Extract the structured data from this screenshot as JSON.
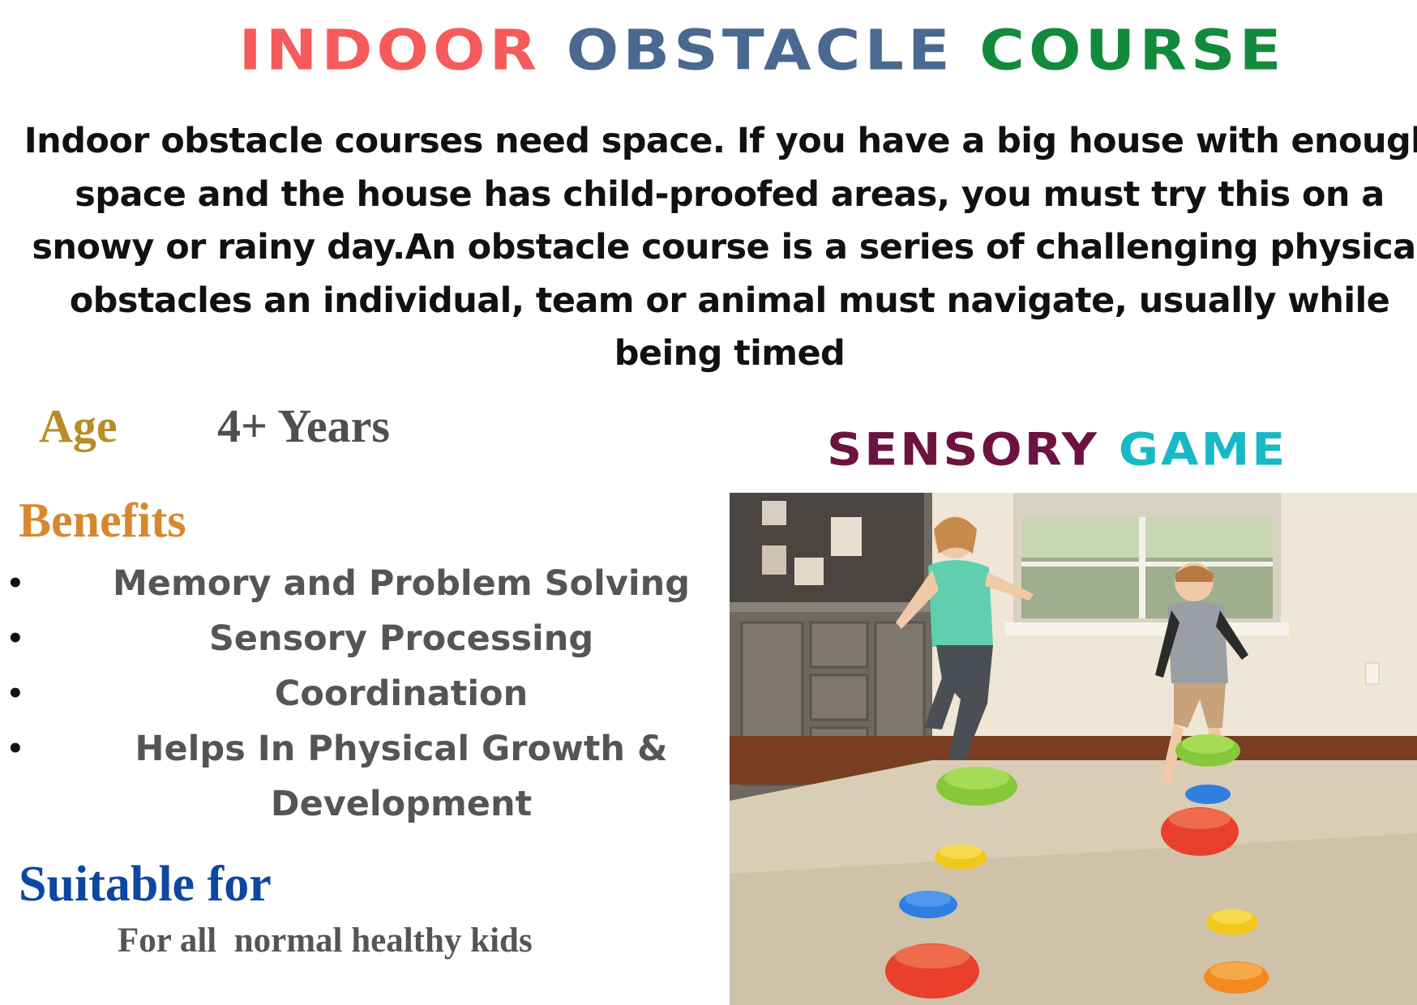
{
  "header": {
    "title_words": [
      "INDOOR",
      "OBSTACLE",
      "COURSE"
    ],
    "title_colors": [
      "#f65a5a",
      "#4a6890",
      "#128a3b"
    ]
  },
  "intro": {
    "lines": [
      "Indoor obstacle courses need space. If you have a big house with enough",
      "space and the house has child-proofed areas, you must try this on a",
      "snowy or rainy day.An obstacle course is a series of challenging physical",
      "obstacles an individual, team or animal must navigate, usually while",
      "being timed"
    ]
  },
  "age": {
    "label": "Age",
    "value": "4+ Years"
  },
  "benefits": {
    "heading": "Benefits",
    "bullet_char": "•",
    "items": [
      "Memory and Problem Solving",
      "Sensory Processing",
      "Coordination",
      "Helps In Physical Growth & Development"
    ]
  },
  "suitable": {
    "heading": "Suitable for",
    "text": "For all  normal healthy kids"
  },
  "game": {
    "title_words": [
      "SENSORY",
      "GAME"
    ],
    "title_colors": [
      "#6d1340",
      "#18b9c6"
    ]
  },
  "photo": {
    "icon": "kids-stepping-stones-photo"
  }
}
